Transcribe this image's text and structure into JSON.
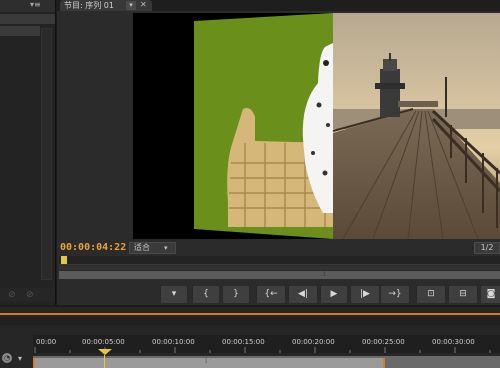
{
  "program_monitor": {
    "tab_title": "节目: 序列 01",
    "menu_icon": "chevron-down-icon",
    "timecode": "00:00:04:22",
    "fit_label": "适合",
    "resolution": "1/2"
  },
  "transport": {
    "buttons": [
      {
        "name": "marker-button",
        "glyph": "▼"
      },
      {
        "name": "mark-in-button",
        "glyph": "{"
      },
      {
        "name": "mark-out-button",
        "glyph": "}"
      },
      {
        "name": "go-to-in-button",
        "glyph": "{←"
      },
      {
        "name": "step-back-button",
        "glyph": "◀|"
      },
      {
        "name": "play-button",
        "glyph": "▶"
      },
      {
        "name": "step-forward-button",
        "glyph": "|▶"
      },
      {
        "name": "go-to-out-button",
        "glyph": "→}"
      },
      {
        "name": "lift-button",
        "glyph": "⊡"
      },
      {
        "name": "extract-button",
        "glyph": "⊟"
      },
      {
        "name": "export-frame-button",
        "glyph": "◙"
      }
    ]
  },
  "timeline": {
    "ruler_ticks": [
      "00:00",
      "00:00:05:00",
      "00:00:10:00",
      "00:00:15:00",
      "00:00:20:00",
      "00:00:25:00",
      "00:00:30:00"
    ]
  },
  "colors": {
    "timecode": "#e8a23c",
    "accent": "#d87e1e",
    "playhead": "#e8c640"
  }
}
